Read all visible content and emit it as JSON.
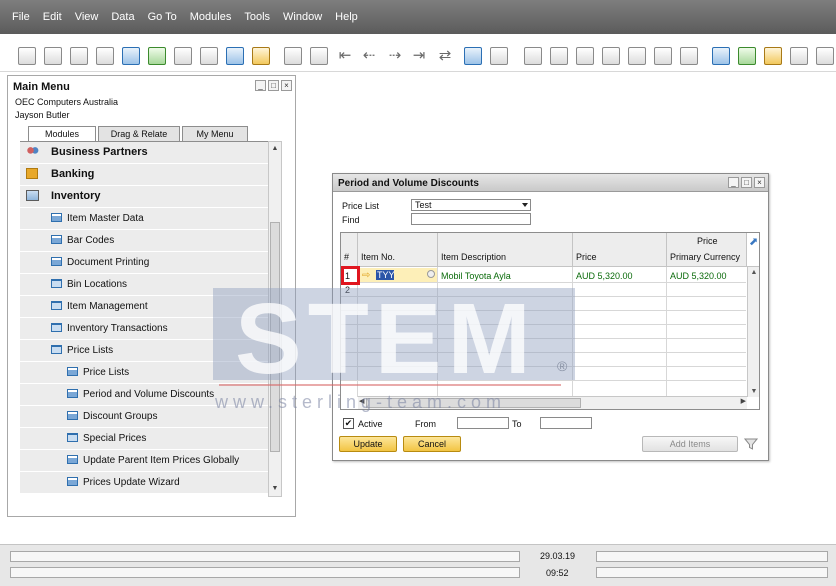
{
  "menu": [
    "File",
    "Edit",
    "View",
    "Data",
    "Go To",
    "Modules",
    "Tools",
    "Window",
    "Help"
  ],
  "main_menu": {
    "title": "Main Menu",
    "company": "OEC Computers Australia",
    "user": "Jayson Butler",
    "tabs": [
      "Modules",
      "Drag & Relate",
      "My Menu"
    ],
    "items": [
      {
        "label": "Business Partners",
        "icon": "partners-icon"
      },
      {
        "label": "Banking",
        "icon": "banking-icon"
      },
      {
        "label": "Inventory",
        "icon": "inventory-icon"
      },
      {
        "label": "Item Master Data",
        "icon": "form-icon"
      },
      {
        "label": "Bar Codes",
        "icon": "form-icon"
      },
      {
        "label": "Document Printing",
        "icon": "form-icon"
      },
      {
        "label": "Bin Locations",
        "icon": "folder-icon"
      },
      {
        "label": "Item Management",
        "icon": "folder-icon"
      },
      {
        "label": "Inventory Transactions",
        "icon": "folder-icon"
      },
      {
        "label": "Price Lists",
        "icon": "folder-open-icon"
      },
      {
        "label": "Price Lists",
        "icon": "form-icon"
      },
      {
        "label": "Period and Volume Discounts",
        "icon": "form-icon"
      },
      {
        "label": "Discount Groups",
        "icon": "form-icon"
      },
      {
        "label": "Special Prices",
        "icon": "folder-icon"
      },
      {
        "label": "Update Parent Item Prices Globally",
        "icon": "form-icon"
      },
      {
        "label": "Prices Update Wizard",
        "icon": "form-icon"
      }
    ]
  },
  "dialog": {
    "title": "Period and Volume Discounts",
    "price_list_label": "Price List",
    "price_list_value": "Test",
    "find_label": "Find",
    "find_value": "",
    "columns": {
      "num": "#",
      "item_no": "Item No.",
      "item_desc": "Item Description",
      "price": "Price",
      "price_group": "Price",
      "primary_currency": "Primary Currency"
    },
    "rows": [
      {
        "num": "1",
        "item_no": "TYY",
        "item_desc": "Mobil Toyota Ayla",
        "price": "AUD 5,320.00",
        "primary_currency": "AUD 5,320.00"
      },
      {
        "num": "2",
        "item_no": "",
        "item_desc": "",
        "price": "",
        "primary_currency": ""
      }
    ],
    "active_label": "Active",
    "active_checked": "✔",
    "from_label": "From",
    "to_label": "To",
    "update_button": "Update",
    "cancel_button": "Cancel",
    "add_items_button": "Add Items"
  },
  "watermark": {
    "text": "STEM",
    "registered": "®",
    "url": "www.sterling-team.com"
  },
  "status": {
    "date": "29.03.19",
    "time": "09:52"
  }
}
